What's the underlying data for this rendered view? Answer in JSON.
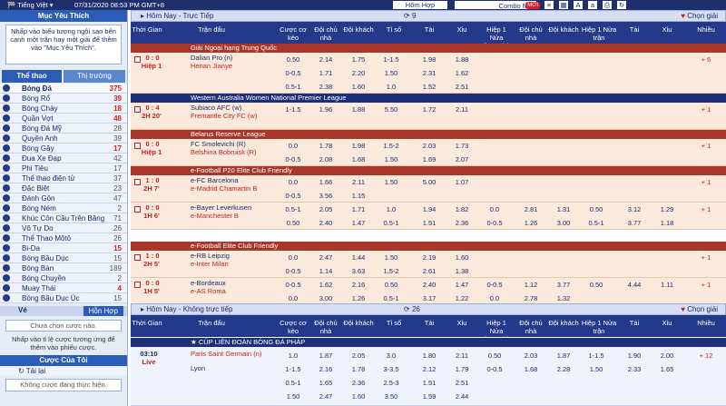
{
  "topbar": {
    "language": "Tiếng Việt",
    "datetime": "07/31/2020 08:53 PM GMT+8",
    "btn_today": "Hôm Hợp",
    "btn_combo": "Combo Mix Parlay",
    "badge": "MỚI"
  },
  "left": {
    "title": "Mục Yêu Thích",
    "fav_hint": "Nhấp vào biểu tượng ngôi sao bên cạnh một trận hay một giải để thêm vào \"Mục Yêu Thích\".",
    "tab_sports": "Thể thao",
    "tab_market": "Thị trường",
    "sports": [
      {
        "name": "Bóng Đá",
        "count": "375",
        "red": true
      },
      {
        "name": "Bóng Rổ",
        "count": "39",
        "red": true
      },
      {
        "name": "Bóng Chày",
        "count": "18",
        "red": true
      },
      {
        "name": "Quần Vợt",
        "count": "48",
        "red": true
      },
      {
        "name": "Bóng Đá Mỹ",
        "count": "28",
        "red": false
      },
      {
        "name": "Quyền Anh",
        "count": "39",
        "red": false
      },
      {
        "name": "Bóng Gậy",
        "count": "17",
        "red": true
      },
      {
        "name": "Đua Xe Đạp",
        "count": "42",
        "red": false
      },
      {
        "name": "Phi Tiêu",
        "count": "17",
        "red": false
      },
      {
        "name": "Thể thao điện tử",
        "count": "37",
        "red": false
      },
      {
        "name": "Đặc Biệt",
        "count": "23",
        "red": false
      },
      {
        "name": "Đánh Gôn",
        "count": "47",
        "red": false
      },
      {
        "name": "Bóng Ném",
        "count": "2",
        "red": false
      },
      {
        "name": "Khúc Côn Cầu Trên Băng",
        "count": "71",
        "red": false
      },
      {
        "name": "Võ Tự Do",
        "count": "26",
        "red": false
      },
      {
        "name": "Thể Thao Môtô",
        "count": "26",
        "red": false
      },
      {
        "name": "Bi-Da",
        "count": "15",
        "red": true
      },
      {
        "name": "Bóng Bầu Dục",
        "count": "15",
        "red": false
      },
      {
        "name": "Bóng Bàn",
        "count": "189",
        "red": false
      },
      {
        "name": "Bóng Chuyền",
        "count": "2",
        "red": false
      },
      {
        "name": "Muay Thái",
        "count": "4",
        "red": true
      },
      {
        "name": "Bóng Bầu Dục Úc",
        "count": "15",
        "red": false
      }
    ],
    "ve": "Vé",
    "mixed": "Hỗn Hợp",
    "pick_btn": "Chưa chọn cược nào.",
    "pick_note": "Nhấp vào tỉ lệ cược tương ứng để thêm vào phiếu cược.",
    "bet_head": "Cược Của Tôi",
    "bet_sub": "Tải lại",
    "no_bet": "Không cược đang thực hiện."
  },
  "live": {
    "title": "Hôm Nay - Trực Tiếp",
    "count": "9",
    "choose": "Chọn giải"
  },
  "cols": [
    "Thời Gian",
    "Trận đấu",
    "Cược cơ kèo",
    "Đội chủ nhà",
    "Đội khách",
    "Tỉ số",
    "Tài",
    "Xỉu",
    "Hiệp 1 Nửa trận.cơ kèo",
    "Đội chủ nhà",
    "Đội khách",
    "Hiệp 1 Nửa trận",
    "Tài",
    "Xỉu",
    "Nhiều"
  ],
  "leagues": [
    {
      "name": "Giải Ngoại hạng Trung Quốc",
      "blue": false
    },
    {
      "name": "Western Australia Women National Premier League",
      "blue": true
    },
    {
      "name": "Belarus Reserve League",
      "blue": false
    },
    {
      "name": "e-Football P20 Elite Club Friendly",
      "blue": false
    },
    {
      "name": "e-Football Elite Club Friendly",
      "blue": false
    }
  ],
  "m1": {
    "score": "0 : 0",
    "time": "Hiệp 1",
    "home": "Dalian Pro (n)",
    "away": "Henan Jianye",
    "r1": [
      "0.50",
      "2.14",
      "1.75",
      "1-1.5",
      "1.98",
      "1.88"
    ],
    "r2": [
      "0-0.5",
      "1.71",
      "2.20",
      "1.50",
      "2.31",
      "1.62"
    ],
    "r3": [
      "0.5-1",
      "2.38",
      "1.60",
      "1.0",
      "1.52",
      "2.51"
    ],
    "more": "+ 6"
  },
  "m2": {
    "score": "0 : 4",
    "time": "2H 20'",
    "home": "Subiaco AFC (w)",
    "away": "Fremantle City FC (w)",
    "r1": [
      "1-1.5",
      "1.96",
      "1.88",
      "5.50",
      "1.72",
      "2.11"
    ],
    "more": "+ 1"
  },
  "m3": {
    "score": "0 : 0",
    "time": "Hiệp 1",
    "home": "FC Smolevichi (R)",
    "away": "Belshina Bobruisk (R)",
    "r1": [
      "0.0",
      "1.78",
      "1.98",
      "1.5-2",
      "2.03",
      "1.73"
    ],
    "r2": [
      "0-0.5",
      "2.08",
      "1.68",
      "1.50",
      "1.69",
      "2.07"
    ],
    "more": "+ 1"
  },
  "m4": {
    "score": "1 : 0",
    "time": "2H 7'",
    "home": "e-FC Barcelona",
    "away": "e-Madrid Chamartin B",
    "r1": [
      "0.0",
      "1.66",
      "2.11",
      "1.50",
      "5.00",
      "1.07"
    ],
    "r2": [
      "0-0.5",
      "3.56",
      "1.15"
    ],
    "more": "+ 1"
  },
  "m5": {
    "score": "0 : 0",
    "time": "1H 6'",
    "home": "e-Bayer Leverkusen",
    "away": "e-Manchester B",
    "r1": [
      "0.5-1",
      "2.05",
      "1.71",
      "1.0",
      "1.94",
      "1.82",
      "0.0",
      "2.81",
      "1.31",
      "0.50",
      "3.12",
      "1.29"
    ],
    "r2": [
      "0.50",
      "2.40",
      "1.47",
      "0.5-1",
      "1.51",
      "2.36",
      "0-0.5",
      "1.26",
      "3.00",
      "0.5-1",
      "3.77",
      "1.18"
    ],
    "more": "+ 1"
  },
  "m6": {
    "score": "1 : 0",
    "time": "2H 5'",
    "home": "e-RB Leipzig",
    "away": "e-Inter Milan",
    "r1": [
      "0.0",
      "2.47",
      "1.44",
      "1.50",
      "2.19",
      "1.60"
    ],
    "r2": [
      "0-0.5",
      "1.14",
      "3.63",
      "1.5-2",
      "2.61",
      "1.38"
    ],
    "more": "+ 1"
  },
  "m7": {
    "score": "0 : 0",
    "time": "1H 5'",
    "home": "e-Bordeaux",
    "away": "e-AS Roma",
    "r1": [
      "0-0.5",
      "1.62",
      "2.16",
      "0.50",
      "2.40",
      "1.47",
      "0-0.5",
      "1.12",
      "3.77",
      "0.50",
      "4.44",
      "1.11"
    ],
    "r2": [
      "0.0",
      "3.00",
      "1.26",
      "0.5-1",
      "3.17",
      "1.22",
      "0.0",
      "2.78",
      "1.32"
    ],
    "more": "+ 1"
  },
  "prematch": {
    "title": "Hôm Nay - Không trực tiếp",
    "count": "26",
    "choose": "Chọn giải",
    "league": "CÚP LIÊN ĐOÀN BÓNG ĐÁ PHÁP",
    "time": "03:10",
    "live": "Live",
    "home": "Paris Saint Germain (n)",
    "away": "Lyon",
    "r1": [
      "1.0",
      "1.87",
      "2.05",
      "3.0",
      "1.80",
      "2.11",
      "0.50",
      "2.03",
      "1.87",
      "1-1.5",
      "1.90",
      "2.00"
    ],
    "r2": [
      "1-1.5",
      "2.16",
      "1.78",
      "3-3.5",
      "2.12",
      "1.79",
      "0-0.5",
      "1.68",
      "2.28",
      "1.50",
      "2.33",
      "1.65"
    ],
    "r3": [
      "0.5-1",
      "1.65",
      "2.36",
      "2.5-3",
      "1.51",
      "2.51"
    ],
    "r4": [
      "1.50",
      "2.47",
      "1.60",
      "3.50",
      "1.59",
      "2.44"
    ],
    "more": "+ 12"
  }
}
